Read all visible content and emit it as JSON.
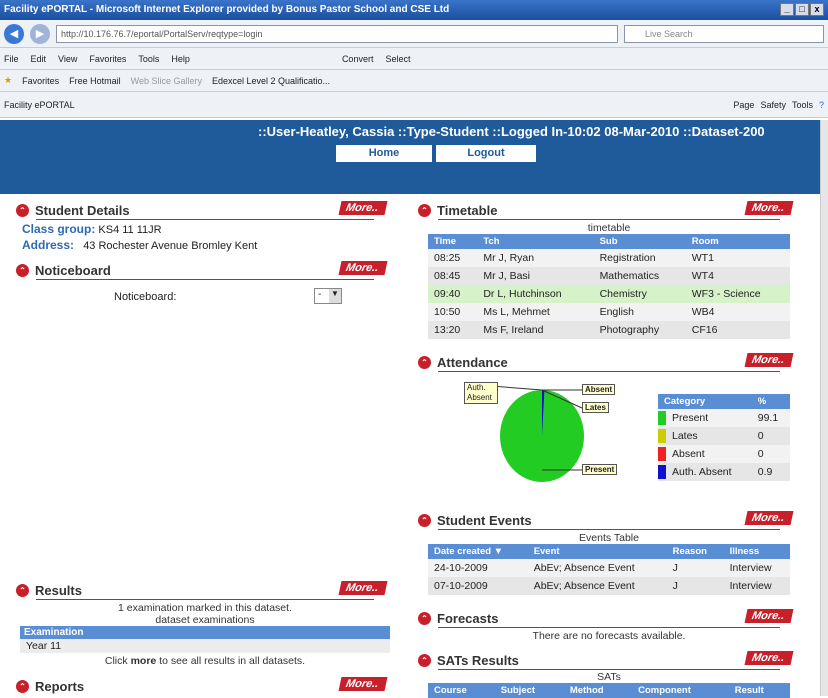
{
  "window": {
    "title": "Facility ePORTAL - Microsoft Internet Explorer provided by Bonus Pastor School and CSE Ltd"
  },
  "browser": {
    "url": "http://10.176.76.7/eportal/PortalServ/reqtype=login",
    "search_placeholder": "Live Search",
    "menu": [
      "File",
      "Edit",
      "View",
      "Favorites",
      "Tools",
      "Help"
    ],
    "convert": "Convert",
    "select": "Select",
    "favorites": "Favorites",
    "fav_links": [
      "Free Hotmail",
      "Web Slice Gallery",
      "Edexcel Level 2 Qualificatio..."
    ],
    "tab": "Facility ePORTAL",
    "cmd": [
      "Page",
      "Safety",
      "Tools"
    ]
  },
  "header": {
    "user_info": "::User-Heatley, Cassia ::Type-Student ::Logged In-10:02 08-Mar-2010 ::Dataset-200",
    "home": "Home",
    "logout": "Logout"
  },
  "more_label": "More..",
  "student": {
    "title": "Student Details",
    "class_label": "Class group:",
    "class_value": "KS4 11 11JR",
    "address_label": "Address:",
    "address_value": "43 Rochester Avenue Bromley Kent"
  },
  "notice": {
    "title": "Noticeboard",
    "label": "Noticeboard:",
    "select_value": "-"
  },
  "results": {
    "title": "Results",
    "line1": "1 examination marked in this dataset.",
    "line2": "dataset examinations",
    "col": "Examination",
    "row": "Year 11",
    "foot_pre": "Click",
    "foot_bold": "more",
    "foot_post": "to see all results in all datasets."
  },
  "reports": {
    "title": "Reports"
  },
  "timetable": {
    "title": "Timetable",
    "caption": "timetable",
    "headers": [
      "Time",
      "Tch",
      "Sub",
      "Room"
    ],
    "rows": [
      [
        "08:25",
        "Mr J, Ryan",
        "Registration",
        "WT1"
      ],
      [
        "08:45",
        "Mr J, Basi",
        "Mathematics",
        "WT4"
      ],
      [
        "09:40",
        "Dr L, Hutchinson",
        "Chemistry",
        "WF3 - Science"
      ],
      [
        "10:50",
        "Ms L, Mehmet",
        "English",
        "WB4"
      ],
      [
        "13:20",
        "Ms F, Ireland",
        "Photography",
        "CF16"
      ]
    ]
  },
  "attendance": {
    "title": "Attendance",
    "callouts": {
      "auth_absent": "Auth. Absent",
      "absent": "Absent",
      "lates": "Lates",
      "present": "Present"
    },
    "headers": [
      "Category",
      "%"
    ],
    "rows": [
      {
        "name": "Present",
        "value": "99.1",
        "color": "#22cc22"
      },
      {
        "name": "Lates",
        "value": "0",
        "color": "#cccc00"
      },
      {
        "name": "Absent",
        "value": "0",
        "color": "#ee2222"
      },
      {
        "name": "Auth. Absent",
        "value": "0.9",
        "color": "#1111cc"
      }
    ]
  },
  "events": {
    "title": "Student Events",
    "caption": "Events Table",
    "headers": [
      "Date created",
      "Event",
      "Reason",
      "Illness"
    ],
    "rows": [
      [
        "24-10-2009",
        "AbEv; Absence Event",
        "J",
        "Interview"
      ],
      [
        "07-10-2009",
        "AbEv; Absence Event",
        "J",
        "Interview"
      ]
    ]
  },
  "forecasts": {
    "title": "Forecasts",
    "text": "There are no forecasts available."
  },
  "sats": {
    "title": "SATs Results",
    "caption": "SATs",
    "headers": [
      "Course",
      "Subject",
      "Method",
      "Component",
      "Result"
    ]
  }
}
